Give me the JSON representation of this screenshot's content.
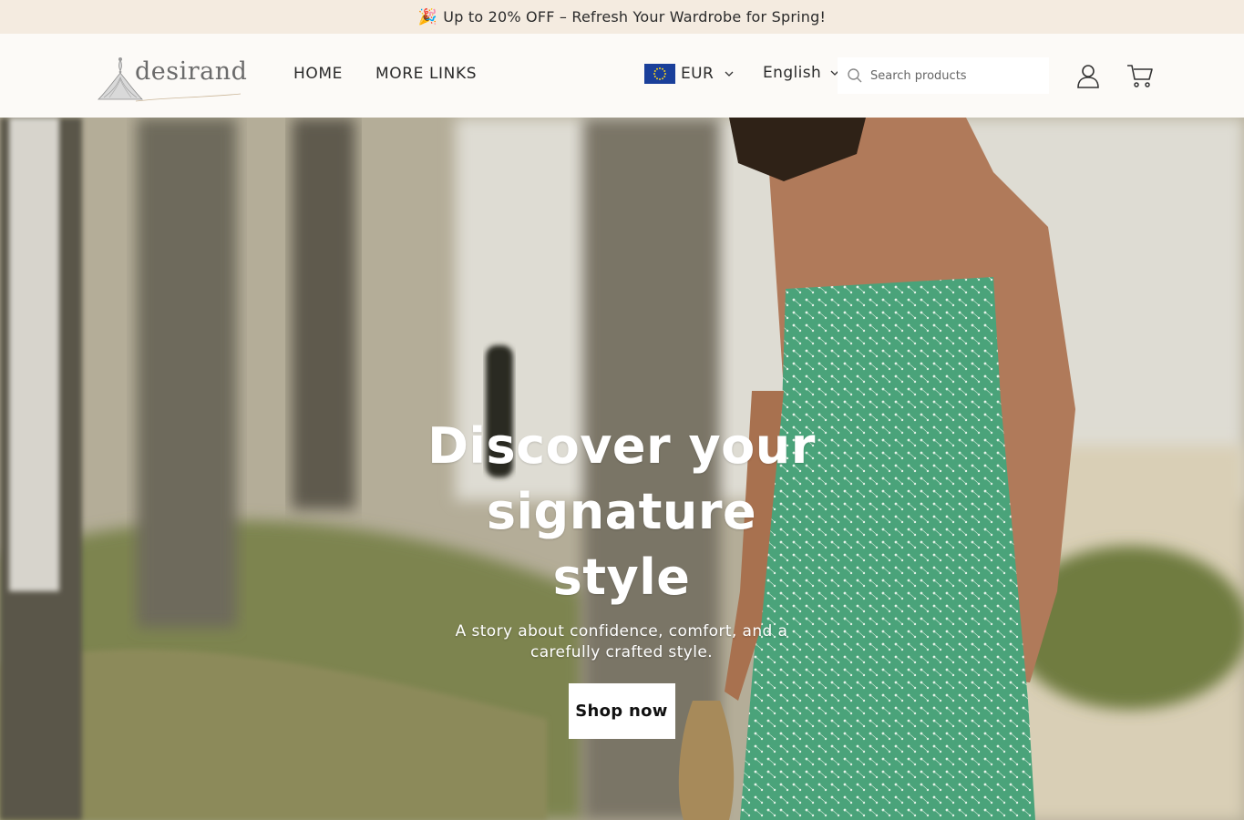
{
  "announcement": {
    "icon": "party-popper-icon",
    "text": "Up to 20% OFF – Refresh Your Wardrobe for Spring!"
  },
  "header": {
    "logo_text": "desirand",
    "nav": [
      {
        "label": "HOME"
      },
      {
        "label": "MORE LINKS"
      }
    ],
    "currency": {
      "label": "EUR",
      "flag": "eu-flag-icon"
    },
    "language": {
      "label": "English"
    },
    "search": {
      "placeholder": "Search products",
      "value": ""
    }
  },
  "hero": {
    "title_line1": "Discover your",
    "title_line2": "signature style",
    "subtitle": "A story about confidence, comfort, and a carefully crafted style.",
    "cta_label": "Shop now"
  },
  "colors": {
    "announcement_bg": "#f4ebe0",
    "header_bg": "#fcfaf7",
    "dress_green": "#4aa37a",
    "cta_bg": "#ffffff"
  }
}
